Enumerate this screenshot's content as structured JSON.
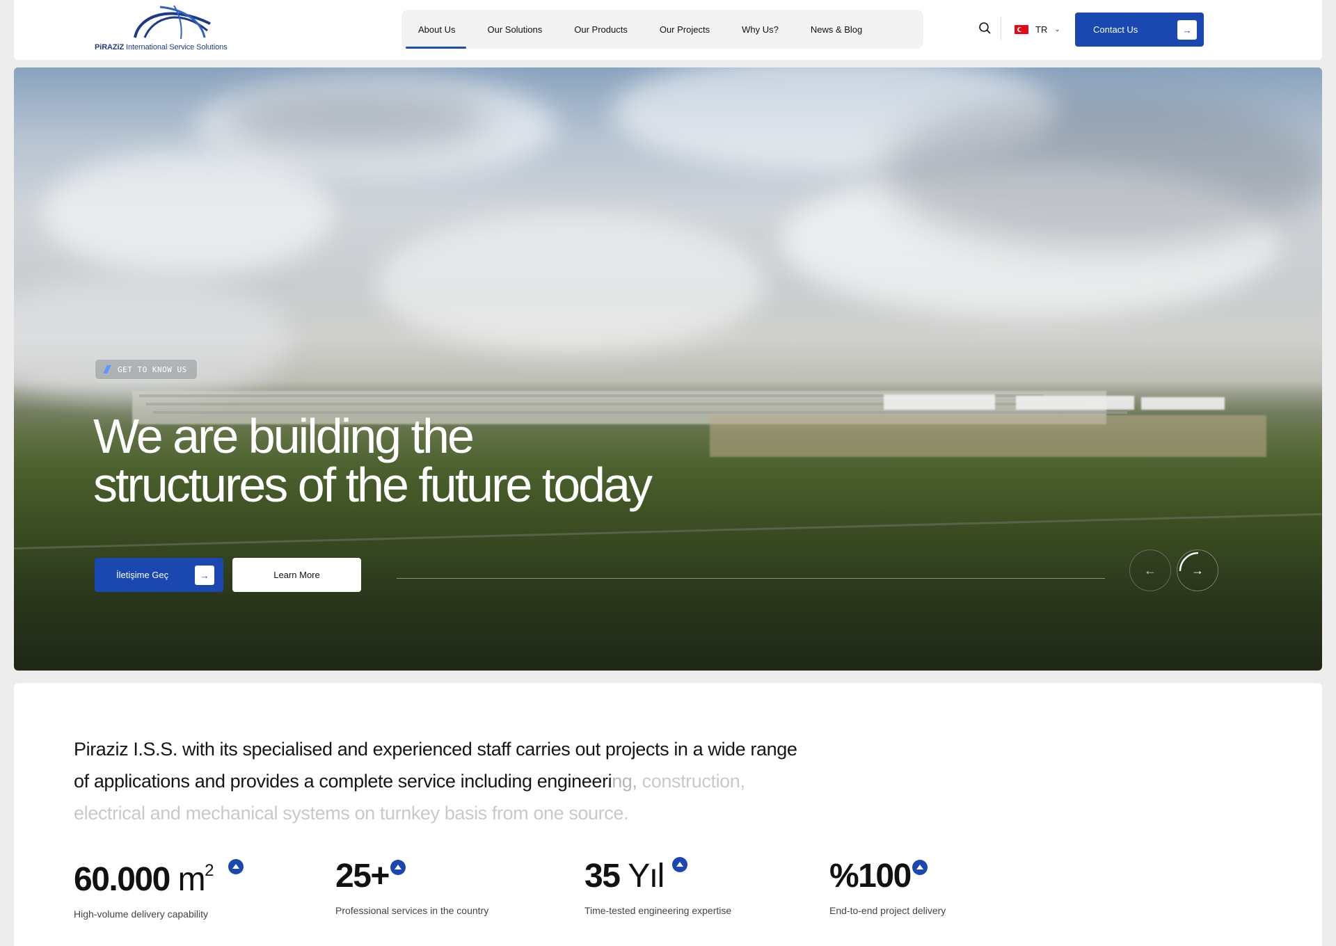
{
  "header": {
    "logo": {
      "brand": "PiRAZiZ",
      "tagline": "International Service Solutions"
    },
    "nav": [
      {
        "label": "About Us",
        "active": true
      },
      {
        "label": "Our Solutions",
        "active": false
      },
      {
        "label": "Our Products",
        "active": false
      },
      {
        "label": "Our Projects",
        "active": false
      },
      {
        "label": "Why Us?",
        "active": false
      },
      {
        "label": "News & Blog",
        "active": false
      }
    ],
    "search_icon": "search-icon",
    "language": {
      "code": "TR",
      "flag": "turkey-flag-icon"
    },
    "contact_button": "Contact Us"
  },
  "hero": {
    "tag": "GET TO KNOW US",
    "title_line1": "We are building the",
    "title_line2": "structures of the future today",
    "primary_button": "İletişime Geç",
    "secondary_button": "Learn More",
    "prev_icon": "arrow-left-icon",
    "next_icon": "arrow-right-icon"
  },
  "about": {
    "text_main": "Piraziz I.S.S. with its specialised and experienced staff carries out projects in a wide range of applications and provides a complete service including engineeri",
    "text_fade_a": "ng,",
    "text_fade_b": "construction, electrical and mechanical systems on turnkey basis from one source."
  },
  "stats": [
    {
      "value": "60.000",
      "unit": "m",
      "sup": "2",
      "label": "High-volume delivery capability"
    },
    {
      "value": "25+",
      "unit": "",
      "sup": "",
      "label": "Professional services in the country"
    },
    {
      "value": "35",
      "unit": "Yıl",
      "sup": "",
      "label": "Time-tested engineering expertise"
    },
    {
      "value": "%100",
      "unit": "",
      "sup": "",
      "label": "End-to-end project delivery"
    }
  ],
  "colors": {
    "accent": "#1b48b0",
    "page_bg": "#ededed"
  }
}
